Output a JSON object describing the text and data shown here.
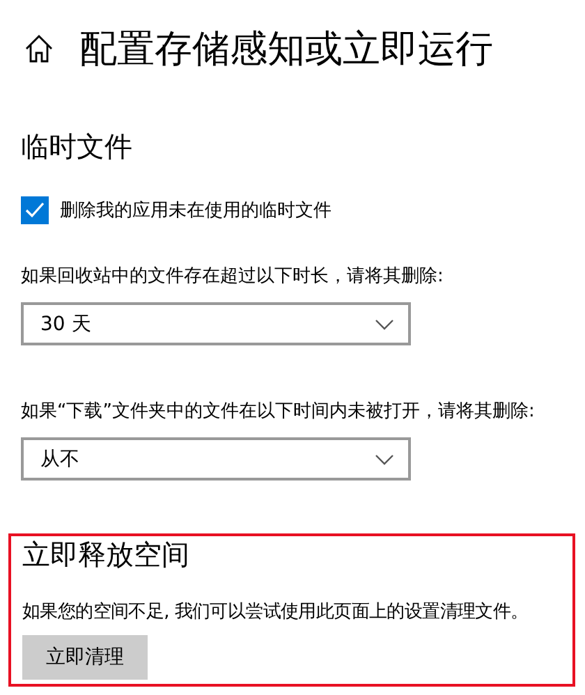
{
  "page": {
    "title": "配置存储感知或立即运行"
  },
  "temp_files": {
    "heading": "临时文件",
    "checkbox": {
      "label": "删除我的应用未在使用的临时文件",
      "checked": true
    },
    "dropdowns": [
      {
        "label": "如果回收站中的文件存在超过以下时长，请将其删除:",
        "value": "30 天"
      },
      {
        "label": "如果“下载”文件夹中的文件在以下时间内未被打开，请将其删除:",
        "value": "从不"
      }
    ]
  },
  "free_space": {
    "heading": "立即释放空间",
    "description": "如果您的空间不足, 我们可以尝试使用此页面上的设置清理文件。",
    "button": "立即清理"
  }
}
